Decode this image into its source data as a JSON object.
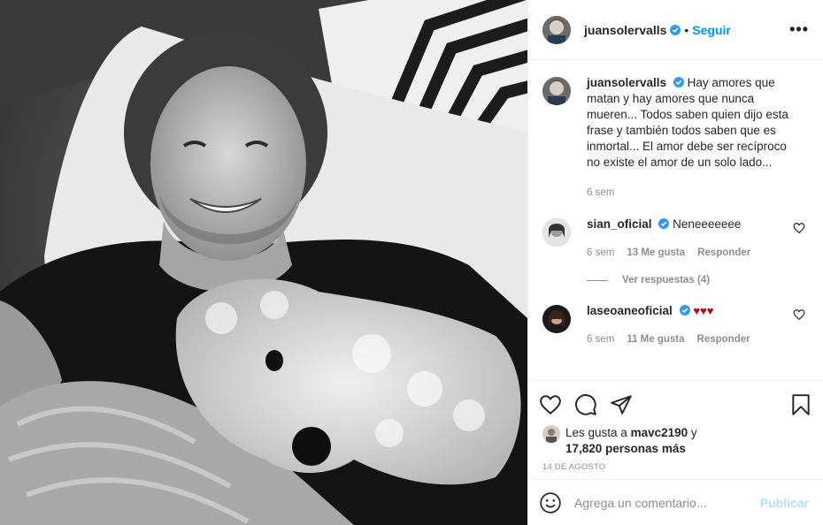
{
  "post": {
    "username": "juansolervalls",
    "follow_label": "Seguir",
    "more_label": "•••",
    "caption_username": "juansolervalls",
    "caption_text": "Hay amores que matan y hay amores que nunca mueren... Todos saben quien dijo esta frase y también todos saben que es inmortal... El amor debe ser recíproco no existe el amor de un solo lado...",
    "caption_time": "6 sem"
  },
  "comments": [
    {
      "username": "sian_oficial",
      "text": "Neneeeeeee",
      "time": "6 sem",
      "likes": "13 Me gusta",
      "reply_label": "Responder",
      "view_replies": "Ver respuestas (4)"
    },
    {
      "username": "laseoaneoficial",
      "text": "♥♥♥",
      "time": "6 sem",
      "likes": "11 Me gusta",
      "reply_label": "Responder"
    }
  ],
  "likes": {
    "prefix": "Les gusta a",
    "user": "mavc2190",
    "conj": "y",
    "count": "17,820 personas más"
  },
  "date": "14 DE AGOSTO",
  "add_comment": {
    "placeholder": "Agrega un comentario...",
    "post_label": "Publicar"
  },
  "colors": {
    "accent": "#0095f6",
    "verified": "#3897f0",
    "hearts": "#c0000c",
    "post_disabled": "#b2dffc"
  },
  "icons": [
    "heart-icon",
    "comment-icon",
    "share-icon",
    "bookmark-icon",
    "emoji-icon",
    "verified-icon"
  ]
}
